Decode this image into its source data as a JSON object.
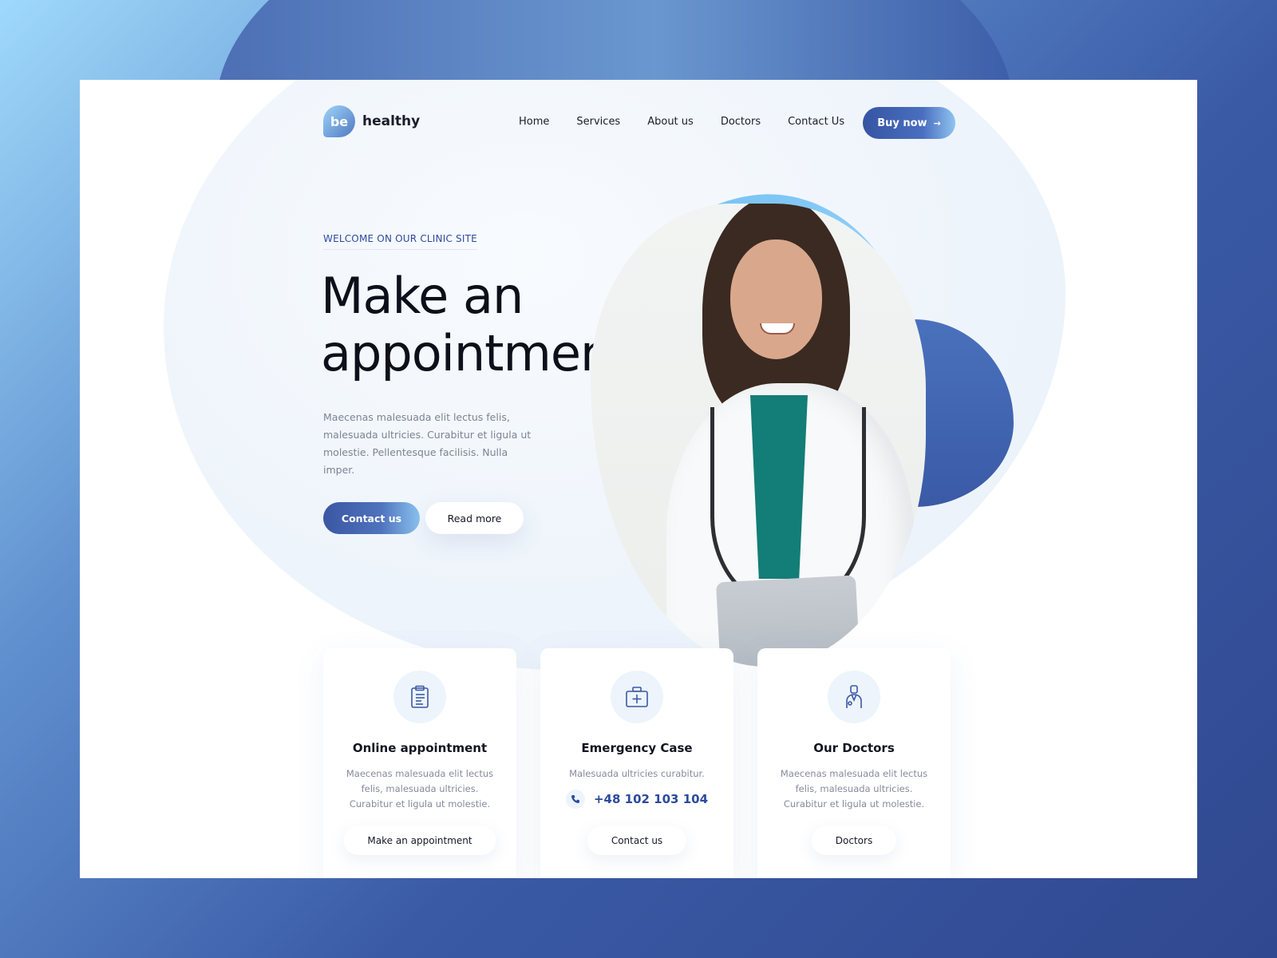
{
  "nav": {
    "logo_mark": "be",
    "logo_text": "healthy",
    "items": [
      "Home",
      "Services",
      "About us",
      "Doctors",
      "Contact Us"
    ],
    "cta": "Buy now"
  },
  "hero": {
    "eyebrow": "WELCOME ON OUR CLINIC SITE",
    "title_line1": "Make an",
    "title_line2": "appointment",
    "description": "Maecenas malesuada elit lectus felis, malesuada ultricies. Curabitur et ligula ut molestie. Pellentesque facilisis. Nulla imper.",
    "primary_button": "Contact us",
    "secondary_button": "Read more"
  },
  "cards": [
    {
      "title": "Online appointment",
      "text": "Maecenas malesuada elit lectus felis, malesuada ultricies. Curabitur et ligula ut molestie.",
      "button": "Make an appointment",
      "icon": "clipboard-icon"
    },
    {
      "title": "Emergency Case",
      "text": "Malesuada ultricies curabitur.",
      "phone": "+48 102 103 104",
      "button": "Contact us",
      "icon": "medical-kit-icon"
    },
    {
      "title": "Our Doctors",
      "text": "Maecenas malesuada elit lectus felis, malesuada ultricies. Curabitur et ligula ut molestie.",
      "button": "Doctors",
      "icon": "doctor-icon"
    }
  ],
  "colors": {
    "brand_dark": "#3654a3",
    "brand_light": "#8fc4f0",
    "accent_text": "#2e4a9e"
  }
}
